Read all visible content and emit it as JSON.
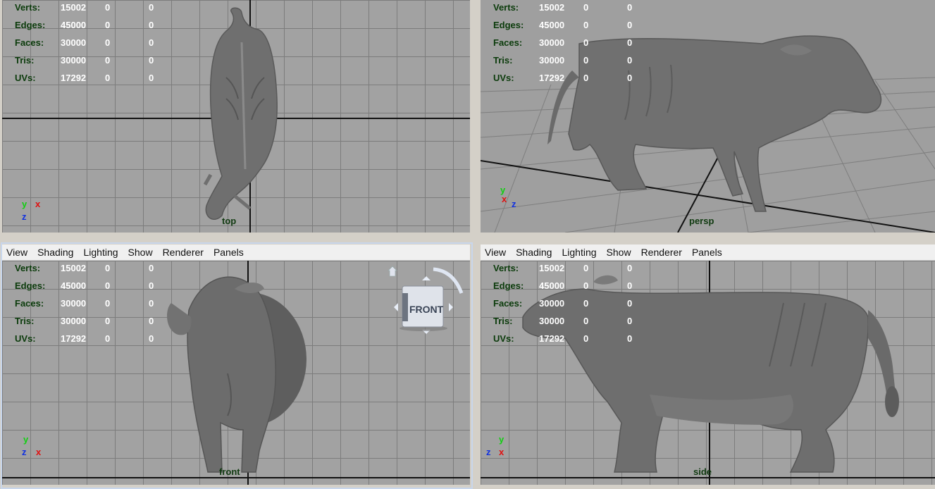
{
  "hud_labels": [
    "Verts:",
    "Edges:",
    "Faces:",
    "Tris:",
    "UVs:"
  ],
  "hud_values": [
    [
      "15002",
      "0",
      "0"
    ],
    [
      "45000",
      "0",
      "0"
    ],
    [
      "30000",
      "0",
      "0"
    ],
    [
      "30000",
      "0",
      "0"
    ],
    [
      "17292",
      "0",
      "0"
    ]
  ],
  "menu": [
    "View",
    "Shading",
    "Lighting",
    "Show",
    "Renderer",
    "Panels"
  ],
  "viewports": {
    "top": {
      "camera": "top"
    },
    "persp": {
      "camera": "persp"
    },
    "front": {
      "camera": "front"
    },
    "side": {
      "camera": "side"
    }
  },
  "viewcube": {
    "label": "FRONT"
  },
  "axes": {
    "x": "x",
    "y": "y",
    "z": "z"
  },
  "colors": {
    "viewport_bg": "#a2a2a2",
    "grid": "#7c7c7c",
    "axis_x": "#e01010",
    "axis_y": "#10d010",
    "axis_z": "#1030e0",
    "mesh": "#6e6e6e"
  }
}
